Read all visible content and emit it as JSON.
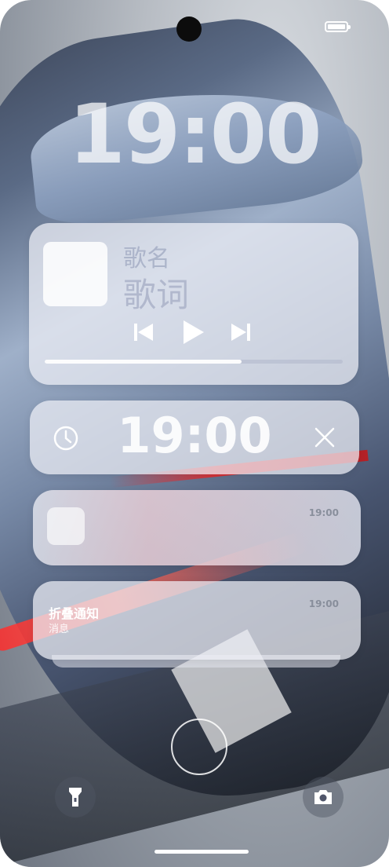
{
  "status_bar": {
    "battery_level": 1.0
  },
  "lock_clock": "19:00",
  "music_widget": {
    "song_title": "歌名",
    "lyrics": "歌词",
    "progress": 0.66,
    "controls": [
      "previous-icon",
      "play-icon",
      "next-icon"
    ]
  },
  "alarm_widget": {
    "time": "19:00",
    "icons": [
      "alarm-clock-icon",
      "close-icon"
    ]
  },
  "notifications": [
    {
      "time": "19:00",
      "title": "",
      "body": ""
    },
    {
      "time": "19:00",
      "title": "折叠通知",
      "body": "消息"
    }
  ],
  "shortcuts": {
    "left": "flashlight-icon",
    "right": "camera-icon"
  },
  "colors": {
    "card_bg": "#eef0f6",
    "text_muted": "#aab2c8"
  }
}
